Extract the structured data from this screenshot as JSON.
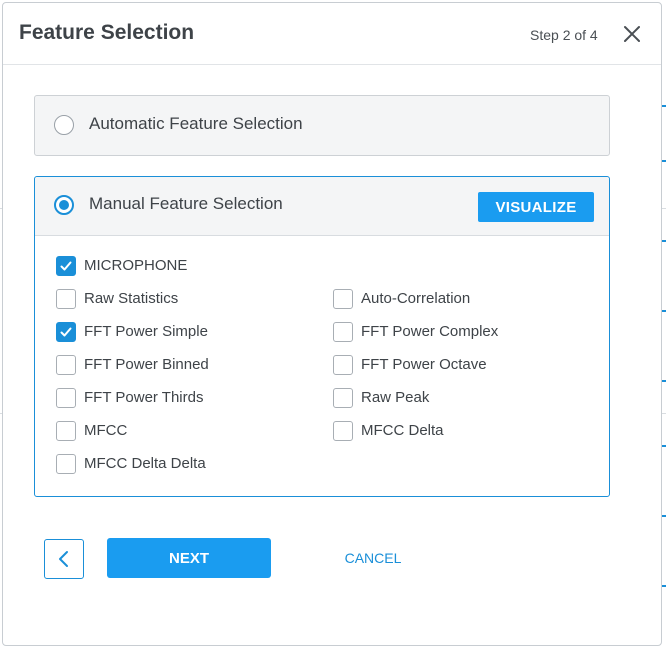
{
  "dialog": {
    "title": "Feature Selection",
    "step": "Step 2 of 4"
  },
  "modes": {
    "automatic_label": "Automatic Feature Selection",
    "manual_label": "Manual Feature Selection",
    "selected": "manual"
  },
  "visualize_label": "VISUALIZE",
  "features": [
    {
      "label": "MICROPHONE",
      "checked": true
    },
    {
      "label": "Raw Statistics",
      "checked": false
    },
    {
      "label": "Auto-Correlation",
      "checked": false
    },
    {
      "label": "FFT Power Simple",
      "checked": true
    },
    {
      "label": "FFT Power Complex",
      "checked": false
    },
    {
      "label": "FFT Power Binned",
      "checked": false
    },
    {
      "label": "FFT Power Octave",
      "checked": false
    },
    {
      "label": "FFT Power Thirds",
      "checked": false
    },
    {
      "label": "Raw Peak",
      "checked": false
    },
    {
      "label": "MFCC",
      "checked": false
    },
    {
      "label": "MFCC Delta",
      "checked": false
    },
    {
      "label": "MFCC Delta Delta",
      "checked": false
    }
  ],
  "footer": {
    "next_label": "NEXT",
    "cancel_label": "CANCEL"
  },
  "icons": {
    "close": "close-icon",
    "back": "chevron-left-icon",
    "check": "checkmark-icon"
  },
  "colors": {
    "accent": "#1a8fd8",
    "button": "#1a9cf0",
    "text": "#3e4348"
  }
}
